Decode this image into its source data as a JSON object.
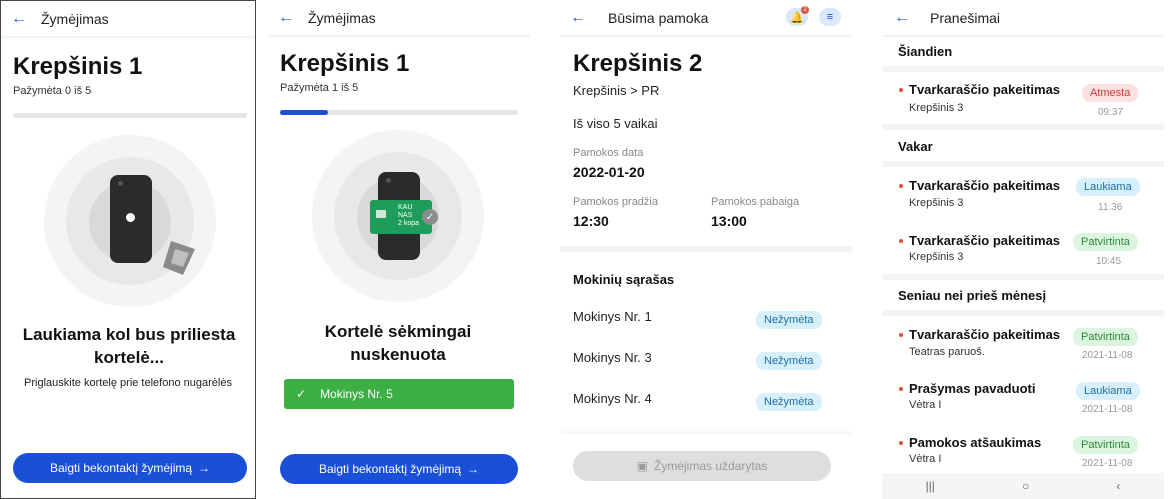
{
  "screen1": {
    "title": "Žymėjimas",
    "heading": "Krepšinis 1",
    "progress_text": "Pažymėta 0 iš 5",
    "progress_value": 0.0,
    "wait_title": "Laukiama kol bus priliesta kortelė...",
    "wait_hint": "Priglauskite kortelę prie telefono nugarėlės",
    "finish_button": "Baigti bekontaktį žymėjimą"
  },
  "screen2": {
    "title": "Žymėjimas",
    "heading": "Krepšinis 1",
    "progress_text": "Pažymėta 1 iš 5",
    "progress_value": 0.2,
    "card_logo_line1": "KAU",
    "card_logo_line2": "NAS",
    "card_logo_line3": "2 kopa",
    "success_title": "Kortelė sėkmingai nuskenuota",
    "success_student": "Mokinys Nr. 5",
    "finish_button": "Baigti bekontaktį žymėjimą"
  },
  "screen3": {
    "title": "Būsima pamoka",
    "notification_count": "2",
    "heading": "Krepšinis 2",
    "path": "Krepšinis > PR",
    "total": "Iš viso 5 vaikai",
    "date_label": "Pamokos data",
    "date_value": "2022-01-20",
    "start_label": "Pamokos pradžia",
    "start_value": "12:30",
    "end_label": "Pamokos pabaiga",
    "end_value": "13:00",
    "list_title": "Mokinių sąrašas",
    "students": [
      {
        "name": "Mokinys Nr. 1",
        "status": "Nežymėta"
      },
      {
        "name": "Mokinys Nr. 3",
        "status": "Nežymėta"
      },
      {
        "name": "Mokinys Nr. 4",
        "status": "Nežymėta"
      }
    ],
    "closed_button": "Žymėjimas uždarytas"
  },
  "screen4": {
    "title": "Pranešimai",
    "today": "Šiandien",
    "yesterday": "Vakar",
    "older": "Seniau nei prieš mėnesį",
    "items": [
      {
        "title": "Tvarkaraščio pakeitimas",
        "sub": "Krepšinis 3",
        "status": "Atmesta",
        "time": "09:37"
      },
      {
        "title": "Tvarkaraščio pakeitimas",
        "sub": "Krepšinis 3",
        "status": "Laukiama",
        "time": "11:36"
      },
      {
        "title": "Tvarkaraščio pakeitimas",
        "sub": "Krepšinis 3",
        "status": "Patvirtinta",
        "time": "10:45"
      },
      {
        "title": "Tvarkaraščio pakeitimas",
        "sub": "Teatras paruoš.",
        "status": "Patvirtinta",
        "time": "2021-11-08"
      },
      {
        "title": "Prašymas pavaduoti",
        "sub": "Vėtra I",
        "status": "Laukiama",
        "time": "2021-11-08"
      },
      {
        "title": "Pamokos atšaukimas",
        "sub": "Vėtra I",
        "status": "Patvirtinta",
        "time": "2021-11-08"
      }
    ]
  }
}
